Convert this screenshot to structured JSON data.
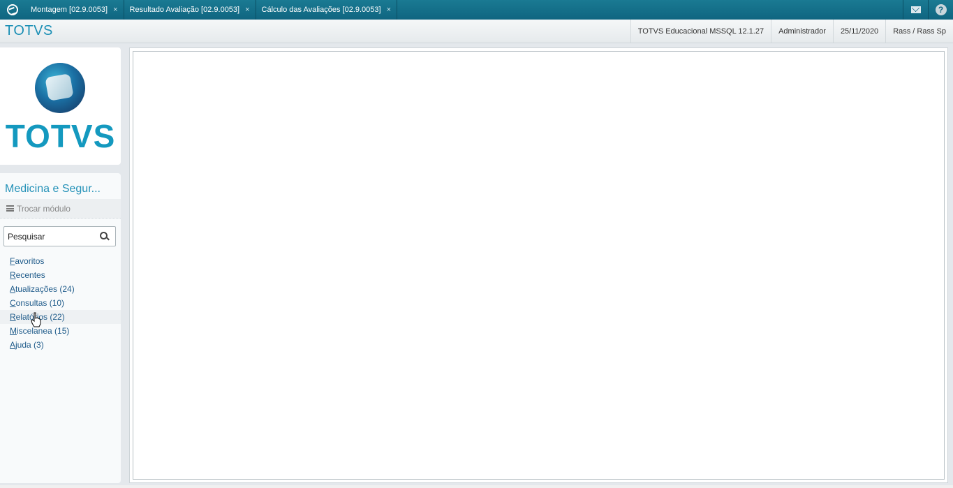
{
  "tabs": [
    {
      "label": "Montagem [02.9.0053]"
    },
    {
      "label": "Resultado Avaliação [02.9.0053]"
    },
    {
      "label": "Cálculo das Avaliações [02.9.0053]"
    }
  ],
  "tab_close": "×",
  "help_glyph": "?",
  "header": {
    "brand": "TOTVS",
    "environment": "TOTVS Educacional MSSQL 12.1.27",
    "user": "Administrador",
    "date": "25/11/2020",
    "company": "Rass / Rass Sp"
  },
  "logo": {
    "text": "TOTVS"
  },
  "sidebar": {
    "module_title": "Medicina e Segur...",
    "switch_module": "Trocar módulo",
    "search_placeholder": "Pesquisar",
    "items": [
      {
        "first": "F",
        "rest": "avoritos"
      },
      {
        "first": "R",
        "rest": "ecentes"
      },
      {
        "first": "A",
        "rest": "tualizações (24)"
      },
      {
        "first": "C",
        "rest": "onsultas (10)"
      },
      {
        "first": "R",
        "rest": "elatórios (22)"
      },
      {
        "first": "M",
        "rest": "iscelanea (15)"
      },
      {
        "first": "A",
        "rest": "juda (3)"
      }
    ]
  },
  "colors": {
    "topbar": "#0f6580",
    "brand": "#1b8fb5",
    "link": "#1f5b8a"
  }
}
